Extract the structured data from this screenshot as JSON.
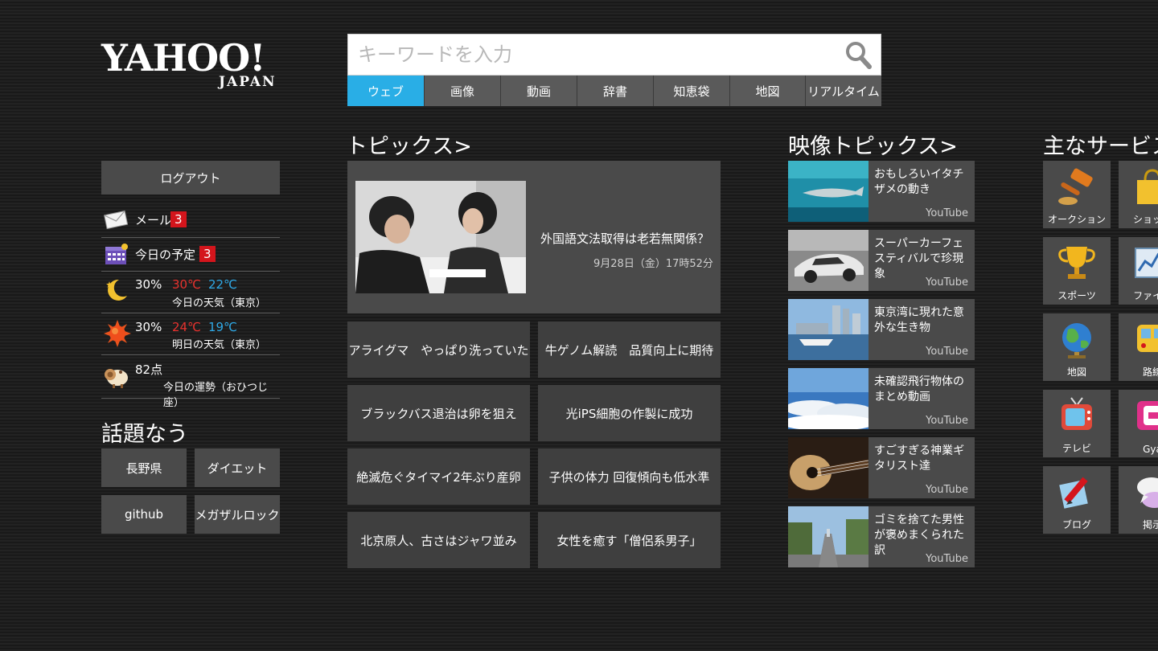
{
  "logo": {
    "main": "YAHOO!",
    "sub": "JAPAN"
  },
  "search": {
    "placeholder": "キーワードを入力",
    "tabs": [
      "ウェブ",
      "画像",
      "動画",
      "辞書",
      "知恵袋",
      "地図",
      "リアルタイム"
    ],
    "active_tab": "ウェブ"
  },
  "account": {
    "logout_label": "ログアウト",
    "mail_label": "メール",
    "mail_count": "3",
    "schedule_label": "今日の予定",
    "schedule_count": "3"
  },
  "weather": {
    "today": {
      "rain": "30%",
      "high": "30℃",
      "low": "22℃",
      "label": "今日の天気（東京）",
      "icon": "moon-icon"
    },
    "tomorrow": {
      "rain": "30%",
      "high": "24℃",
      "low": "19℃",
      "label": "明日の天気（東京）",
      "icon": "sun-icon"
    }
  },
  "fortune": {
    "score": "82点",
    "label": "今日の運勢（おひつじ座）"
  },
  "trending": {
    "title": "話題なう",
    "tags": [
      "長野県",
      "ダイエット",
      "github",
      "メガザルロック"
    ]
  },
  "topics": {
    "title": "トピックス>",
    "featured": {
      "headline": "外国語文法取得は老若無関係？",
      "date": "9月28日（金）17時52分"
    },
    "items": [
      "アライグマ　やっぱり洗っていた",
      "牛ゲノム解読　品質向上に期待",
      "ブラックバス退治は卵を狙え",
      "光iPS細胞の作製に成功",
      "絶滅危ぐタイマイ2年ぶり産卵",
      "子供の体力 回復傾向も低水準",
      "北京原人、古さはジャワ並み",
      "女性を癒す「僧侶系男子」"
    ]
  },
  "video": {
    "title": "映像トピックス>",
    "items": [
      {
        "title": "おもしろいイタチザメの動き",
        "source": "YouTube"
      },
      {
        "title": "スーパーカーフェスティバルで珍現象",
        "source": "YouTube"
      },
      {
        "title": "東京湾に現れた意外な生き物",
        "source": "YouTube"
      },
      {
        "title": "未確認飛行物体のまとめ動画",
        "source": "YouTube"
      },
      {
        "title": "すごすぎる神業ギタリスト達",
        "source": "YouTube"
      },
      {
        "title": "ゴミを捨てた男性が褒めまくられた訳",
        "source": "YouTube"
      }
    ]
  },
  "services": {
    "title": "主なサービス",
    "items": [
      {
        "label": "オークション",
        "icon": "gavel-icon"
      },
      {
        "label": "ショッピ",
        "icon": "shopping-bag-icon"
      },
      {
        "label": "スポーツ",
        "icon": "trophy-icon"
      },
      {
        "label": "ファイナ",
        "icon": "finance-chart-icon"
      },
      {
        "label": "地図",
        "icon": "globe-icon"
      },
      {
        "label": "路線",
        "icon": "train-icon"
      },
      {
        "label": "テレビ",
        "icon": "tv-icon"
      },
      {
        "label": "Gya",
        "icon": "gyao-icon"
      },
      {
        "label": "ブログ",
        "icon": "blog-pen-icon"
      },
      {
        "label": "掲示",
        "icon": "chat-bubble-icon"
      }
    ]
  },
  "colors": {
    "accent": "#29aee6",
    "badge": "#d4151c",
    "tile": "#4a4a4a",
    "high_temp": "#e8322e",
    "low_temp": "#2fa9e6"
  }
}
